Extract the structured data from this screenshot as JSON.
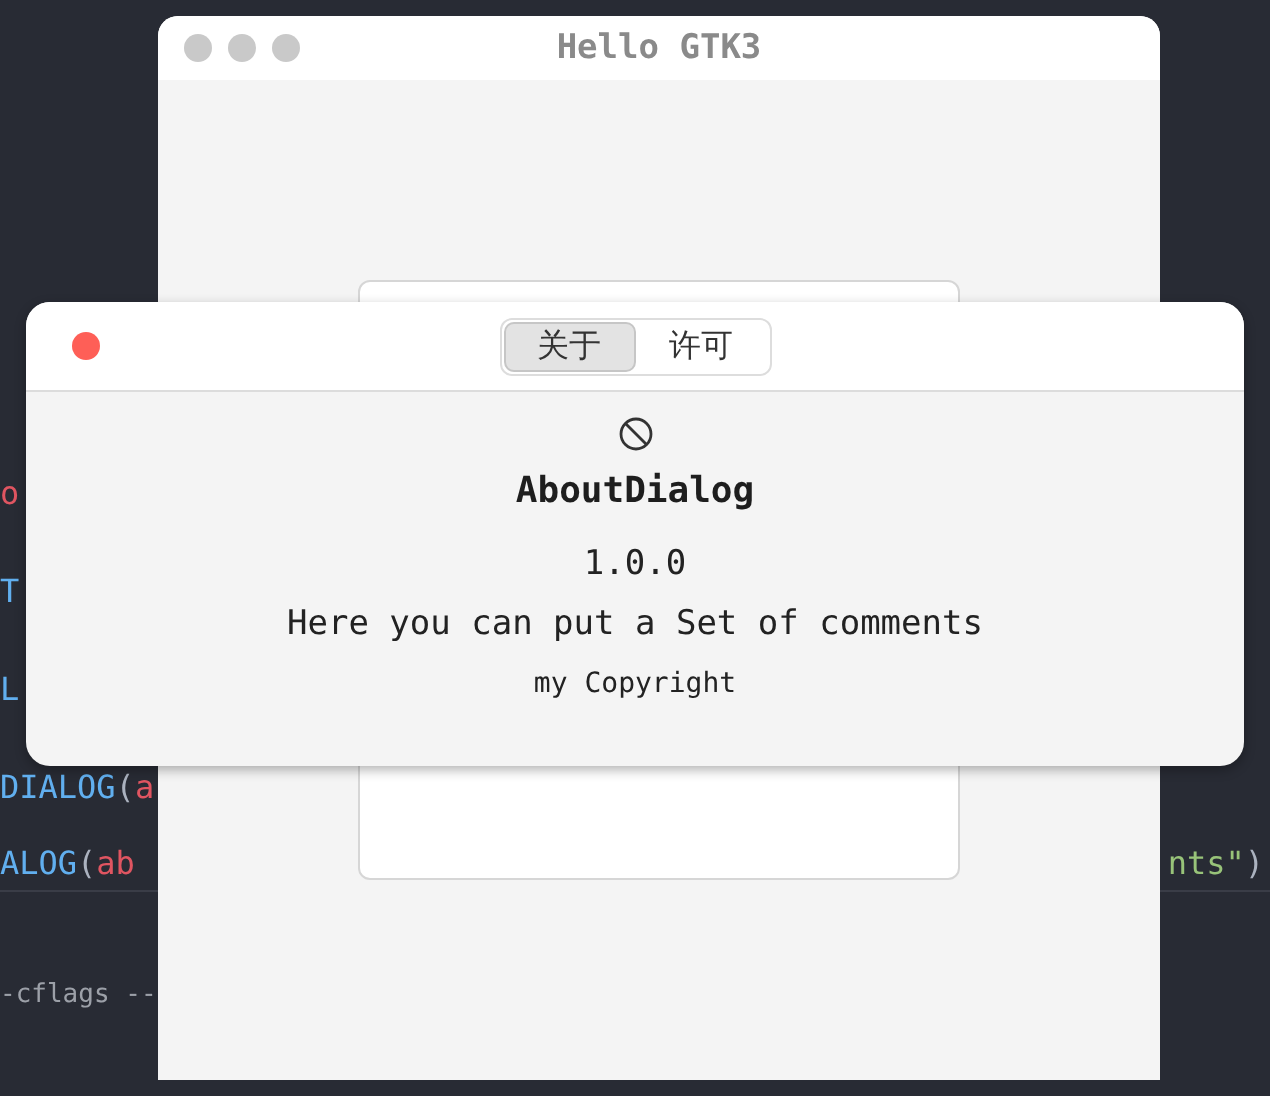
{
  "editor": {
    "lines": [
      {
        "left": [
          {
            "text": "o",
            "color": "#e05561"
          }
        ]
      },
      {
        "left": [
          {
            "text": "T",
            "color": "#61afef"
          }
        ]
      },
      {
        "left": [
          {
            "text": "L",
            "color": "#61afef"
          }
        ]
      },
      {
        "left": [
          {
            "text": "DIALOG",
            "color": "#61afef"
          },
          {
            "text": "(",
            "color": "#abb2bf"
          },
          {
            "text": "a",
            "color": "#e05561"
          }
        ]
      },
      {
        "left": [
          {
            "text": "ALOG",
            "color": "#61afef"
          },
          {
            "text": "(",
            "color": "#abb2bf"
          },
          {
            "text": "ab",
            "color": "#e05561"
          }
        ],
        "right": [
          {
            "text": "nts\"",
            "color": "#98c379"
          },
          {
            "text": ")",
            "color": "#abb2bf"
          }
        ]
      }
    ]
  },
  "terminal": {
    "text": "-cflags --"
  },
  "main_window": {
    "title": "Hello GTK3"
  },
  "about_dialog": {
    "tabs": [
      {
        "label": "关于",
        "selected": true
      },
      {
        "label": "许可",
        "selected": false
      }
    ],
    "program_name": "AboutDialog",
    "version": "1.0.0",
    "comments": "Here you can put a Set of comments",
    "copyright": "my Copyright"
  }
}
